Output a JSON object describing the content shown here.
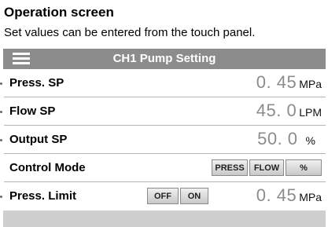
{
  "heading": "Operation screen",
  "subtitle": "Set values can be entered from the touch panel.",
  "screen": {
    "title": "CH1 Pump Setting",
    "rows": [
      {
        "label": "Press. SP",
        "value": "0. 45",
        "unit": "MPa"
      },
      {
        "label": "Flow SP",
        "value": "45. 0",
        "unit": "LPM"
      },
      {
        "label": "Output SP",
        "value": "50. 0",
        "unit": "%"
      }
    ],
    "control_mode": {
      "label": "Control Mode",
      "buttons": [
        "PRESS",
        "FLOW",
        "%"
      ]
    },
    "press_limit": {
      "label": "Press. Limit",
      "off_label": "OFF",
      "on_label": "ON",
      "value": "0. 45",
      "unit": "MPa"
    }
  },
  "colors": {
    "title_bar": "#8c8c8c",
    "value_text": "#8c8c8c",
    "bottom_bar": "#cfcfcf"
  },
  "icons": {
    "menu": "hamburger-menu-icon"
  }
}
